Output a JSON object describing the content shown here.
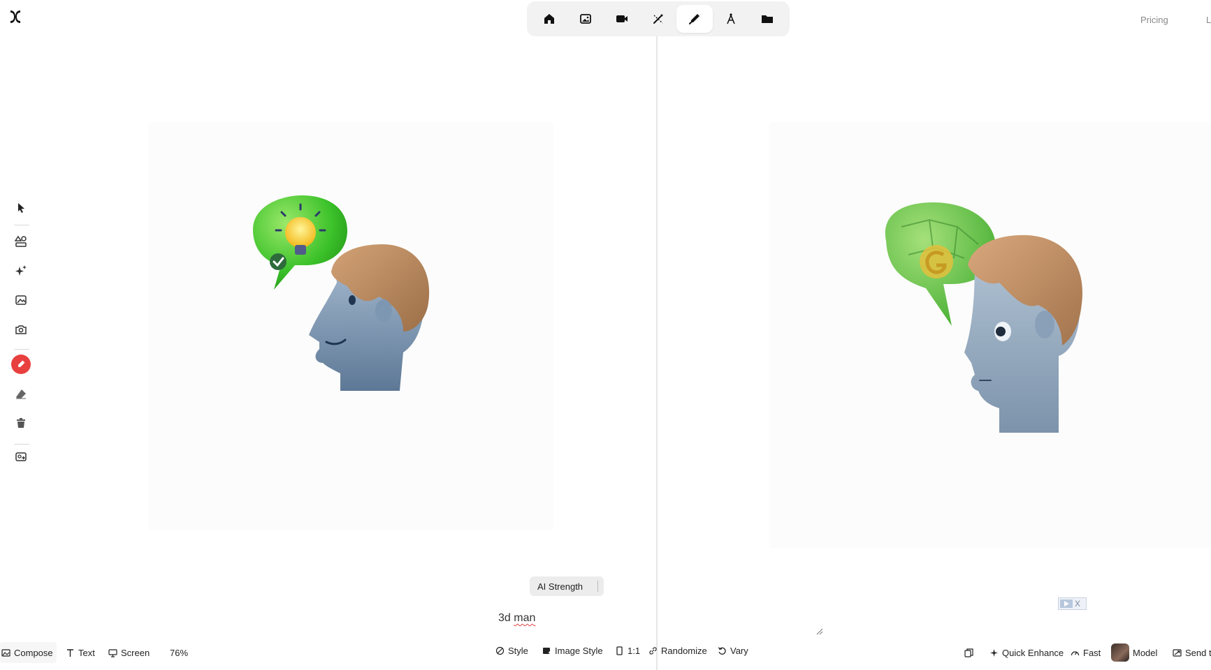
{
  "nav": {
    "items": [
      {
        "name": "home-icon",
        "active": false
      },
      {
        "name": "image-icon",
        "active": false
      },
      {
        "name": "video-icon",
        "active": false
      },
      {
        "name": "enhance-wand-icon",
        "active": false
      },
      {
        "name": "brush-pen-icon",
        "active": true
      },
      {
        "name": "compass-icon",
        "active": false
      },
      {
        "name": "folder-icon",
        "active": false
      }
    ],
    "pricing_label": "Pricing",
    "trailing_label": "L"
  },
  "left_toolbar": {
    "tools": [
      "pointer-icon",
      "shapes-icon",
      "sparkles-icon",
      "image-icon",
      "camera-icon",
      "brush-tool-icon",
      "eraser-icon",
      "trash-icon",
      "image-swap-icon"
    ],
    "active_tool": "brush-tool-icon",
    "accent_color": "#e8403f"
  },
  "editor": {
    "ai_strength_label": "AI Strength",
    "prompt_words": [
      "3d",
      "man"
    ]
  },
  "bottom_left": {
    "compose_label": "Compose",
    "text_label": "Text",
    "screen_label": "Screen",
    "zoom": "76%"
  },
  "bottom_center": {
    "style_label": "Style",
    "image_style_label": "Image Style",
    "aspect_label": "1:1",
    "randomize_label": "Randomize",
    "vary_label": "Vary"
  },
  "bottom_right": {
    "quick_enhance_label": "Quick Enhance",
    "fast_label": "Fast",
    "model_label": "Model",
    "send_label": "Send t"
  }
}
